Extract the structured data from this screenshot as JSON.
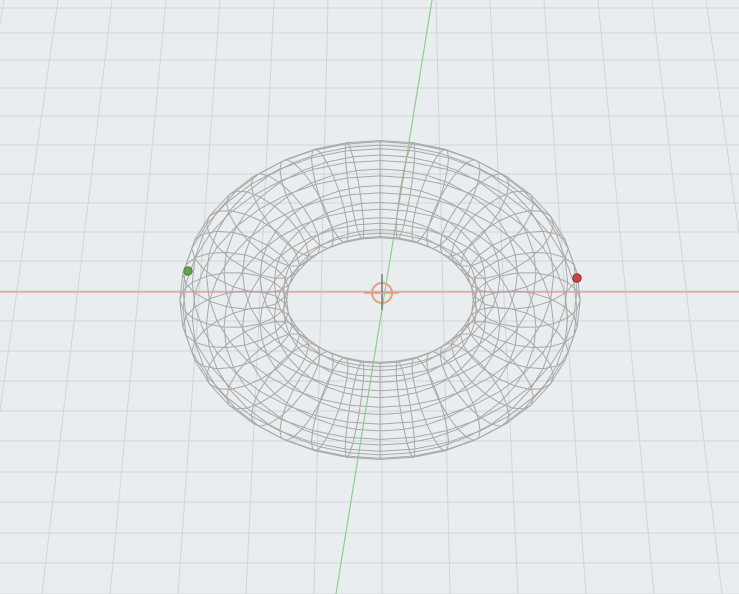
{
  "viewport": {
    "background": "#e9edf0",
    "grid_color": "#cfd5da",
    "x_axis_color": "#e59a9a",
    "y_axis_color": "#8fce8f",
    "wireframe_color": "#a8a8a8"
  },
  "scene": {
    "object": "torus-wireframe",
    "pivot_icon": "pivot-crosshair-icon",
    "green_marker": "green-vertex-marker",
    "red_marker": "red-vertex-marker",
    "green_marker_color": "#6aa04a",
    "red_marker_color": "#c74646"
  }
}
